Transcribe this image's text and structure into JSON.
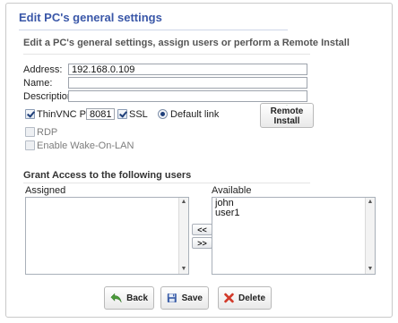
{
  "dialog": {
    "title": "Edit PC's general settings",
    "subtitle": "Edit a PC's general settings, assign users or perform a Remote Install"
  },
  "form": {
    "address_label": "Address:",
    "address_value": "192.168.0.109",
    "name_label": "Name:",
    "name_value": "",
    "description_label": "Description:",
    "description_value": ""
  },
  "options": {
    "thinvnc_label": "ThinVNC Port:",
    "thinvnc_checked": true,
    "port_value": "8081",
    "ssl_label": "SSL",
    "ssl_checked": true,
    "default_link_label": "Default link",
    "default_link_selected": true,
    "rdp_label": "RDP",
    "rdp_checked": false,
    "wol_label": "Enable Wake-On-LAN",
    "wol_checked": false
  },
  "remote_install": {
    "label": "Remote Install",
    "icon": "download-icon"
  },
  "access": {
    "heading": "Grant Access to the following users",
    "assigned_label": "Assigned",
    "available_label": "Available",
    "assigned_items": [],
    "available_items": [
      "john",
      "user1"
    ],
    "move_left_label": "<<",
    "move_right_label": ">>"
  },
  "actions": {
    "back_label": "Back",
    "save_label": "Save",
    "delete_label": "Delete"
  },
  "colors": {
    "title": "#3a57a8",
    "back_arrow": "#4a9a3a",
    "delete_x": "#d23a2a",
    "save_disk": "#3b5ea8"
  }
}
